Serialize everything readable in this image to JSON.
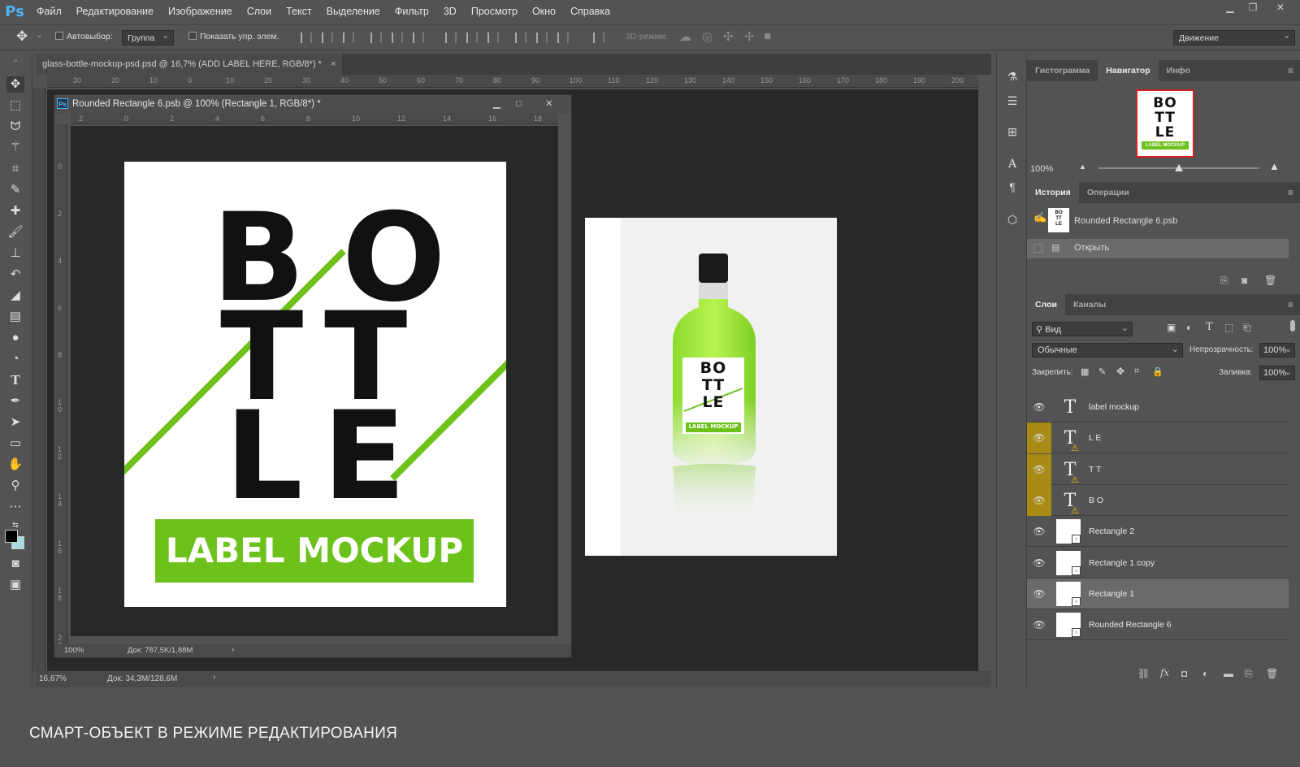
{
  "app": {
    "logo": "Ps"
  },
  "menu": [
    "Файл",
    "Редактирование",
    "Изображение",
    "Слои",
    "Текст",
    "Выделение",
    "Фильтр",
    "3D",
    "Просмотр",
    "Окно",
    "Справка"
  ],
  "options": {
    "autoselect_label": "Автовыбор:",
    "autoselect_value": "Группа",
    "show_transform_label": "Показать упр. элем.",
    "mode3d_label": "3D-режим:",
    "workspace": "Движение"
  },
  "document_tab": {
    "title": "glass-bottle-mockup-psd.psd @ 16,7% (ADD LABEL HERE, RGB/8*) *",
    "close": "×"
  },
  "inner_window": {
    "title": "Rounded Rectangle 6.psb @ 100% (Rectangle 1, RGB/8*) *",
    "icon": "Ps",
    "zoom": "100%",
    "doc_info": "Док: 787,5K/1,88M"
  },
  "outer_ruler_ticks": [
    "30",
    "20",
    "10",
    "0",
    "10",
    "20",
    "30",
    "40",
    "50",
    "60",
    "70",
    "80",
    "90",
    "100",
    "110",
    "120",
    "130",
    "140",
    "150",
    "160",
    "170",
    "180",
    "190",
    "200"
  ],
  "inner_ruler_ticks": [
    "2",
    "0",
    "2",
    "4",
    "6",
    "8",
    "10",
    "12",
    "14",
    "16",
    "18"
  ],
  "inner_vruler_ticks": [
    "0",
    "2",
    "4",
    "6",
    "8",
    "10",
    "12",
    "14",
    "16",
    "18",
    "20"
  ],
  "label_art": {
    "row1": [
      "B",
      "O"
    ],
    "row2": [
      "T",
      "T"
    ],
    "row3": [
      "L",
      "E"
    ],
    "band_text": "LABEL MOCKUP",
    "accent_color": "#6cc11a"
  },
  "mockup_label": {
    "row1": "BO",
    "row2": "TT",
    "row3": "LE",
    "band_text": "LABEL MOCKUP"
  },
  "status": {
    "zoom": "16,67%",
    "doc_info": "Док: 34,3M/128,6M"
  },
  "navigator": {
    "tabs": [
      "Гистограмма",
      "Навигатор",
      "Инфо"
    ],
    "active_tab": "Навигатор",
    "zoom": "100%",
    "zoom_position": 0.5,
    "thumb": {
      "row1": "BO",
      "row2": "TT",
      "row3": "LE",
      "band": "LABEL MOCKUP"
    }
  },
  "history": {
    "tabs": [
      "История",
      "Операции"
    ],
    "snapshot": "Rounded Rectangle 6.psb",
    "items": [
      "Открыть"
    ]
  },
  "layers_panel": {
    "tabs": [
      "Слои",
      "Каналы"
    ],
    "filter": "Вид",
    "blend_mode": "Обычные",
    "opacity_label": "Непрозрачность:",
    "opacity": "100%",
    "lock_label": "Закрепить:",
    "fill_label": "Заливка:",
    "fill": "100%",
    "layers": [
      {
        "name": "label mockup",
        "kind": "text",
        "warn": false,
        "selected": false
      },
      {
        "name": "L E",
        "kind": "text",
        "warn": true,
        "selected": false
      },
      {
        "name": "T T",
        "kind": "text",
        "warn": true,
        "selected": false
      },
      {
        "name": "B O",
        "kind": "text",
        "warn": true,
        "selected": false
      },
      {
        "name": "Rectangle 2",
        "kind": "smart",
        "warn": false,
        "selected": false
      },
      {
        "name": "Rectangle 1 copy",
        "kind": "smart",
        "warn": false,
        "selected": false
      },
      {
        "name": "Rectangle 1",
        "kind": "smart",
        "warn": false,
        "selected": true
      },
      {
        "name": "Rounded Rectangle 6",
        "kind": "smart",
        "warn": false,
        "selected": false
      }
    ]
  },
  "caption": "СМАРТ-ОБЪЕКТ В РЕЖИМЕ РЕДАКТИРОВАНИЯ",
  "colors": {
    "ui_bg": "#535353",
    "canvas_bg": "#282828",
    "accent_green": "#6cc11a",
    "warning_gold": "#a88a17"
  }
}
